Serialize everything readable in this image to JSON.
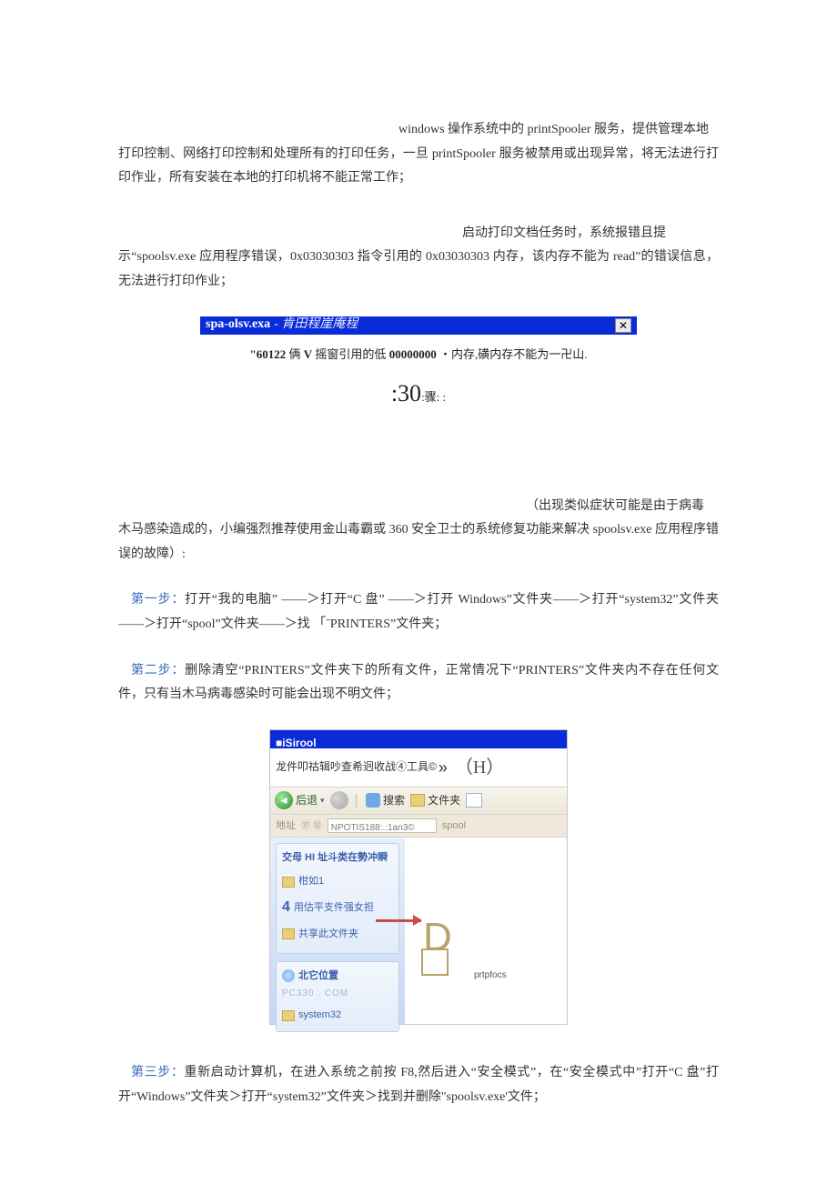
{
  "intro": {
    "lead": "windows 操作系统中的 printSpooler 服务，提供管理本地",
    "body": "打印控制、网络打印控制和处理所有的打印任务，一旦 printSpooler 服务被禁用或出现异常，将无法进行打印作业，所有安装在本地的打印机将不能正常工作；"
  },
  "symptom": {
    "lead": "启动打印文档任务时，系统报错且提",
    "body": "示“spoolsv.exe 应用程序错误，0x03030303 指令引用的 0x03030303 内存，该内存不能为 read”的错误信息，无法进行打印作业；"
  },
  "error_dialog": {
    "title_main": "spa-olsv.exa",
    "title_sub": "- 肯田程崖庵程",
    "line1_a": "\"60122",
    "line1_b": "俩",
    "line1_c": "V",
    "line1_d": "摇窗引用的低",
    "line1_e": "00000000",
    "line1_f": "・内存,磺内存不能为一卍山.",
    "line2_big": ":30",
    "line2_small": ":骤: :"
  },
  "cause": {
    "lead": "（出现类似症状可能是由于病毒",
    "body": "木马感染造成的，小编强烈推荐使用金山毒霸或 360 安全卫士的系统修复功能来解决 spoolsv.exe 应用程序错误的故障）:"
  },
  "steps": {
    "s1_label": "第一步：",
    "s1_text": "打开“我的电脑” ——＞打开“C 盘” ——＞打开 Windows”文件夹——＞打开“system32”文件夹——＞打开“spool”文件夹——＞找 「ˉPRINTERS”文件夹；",
    "s2_label": "第二步：",
    "s2_text": "删除清空“PRINTERS”文件夹下的所有文件，正常情况下“PRINTERS”文件夹内不存在任何文件，只有当木马病毒感染时可能会出现不明文件；",
    "s3_label": "第三步：",
    "s3_text": "重新启动计算机，在进入系统之前按 F8,然后进入“安全模式”，在“安全模式中”打开“C 盘”打开“Windows”文件夹＞打开“system32”文件夹＞找到并删除\"spoolsv.exe'文件；"
  },
  "explorer": {
    "title": "■iSirool",
    "menu_text": "龙件叩祜辑吵查希迥收战④工具©",
    "menu_raquo": "»",
    "menu_h": "（H）",
    "back": "后退",
    "search": "搜索",
    "folders": "文件夹",
    "addr_label": "地址",
    "addr_path": "NPOTIS188:.:1an3©",
    "spool": "spool",
    "side_title": "交母 HI 址斗类在勢冲瞬",
    "side_item1": "柑如1",
    "side_item2": "用估平支件强女担",
    "side_item3": "共享此文件夹",
    "side2_title": "北它位置",
    "watermark": "PC330 . COM",
    "system32": "system32",
    "big_d": "D",
    "prt": "prtpfocs"
  }
}
